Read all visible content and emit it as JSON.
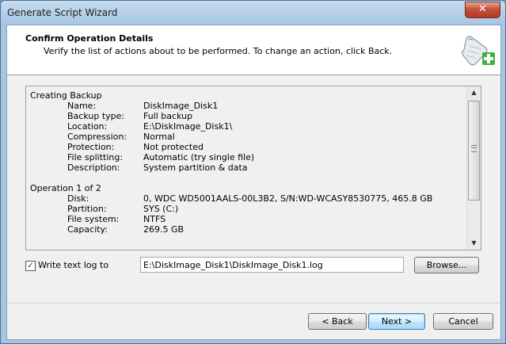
{
  "window": {
    "title": "Generate Script Wizard",
    "close_glyph": "✕"
  },
  "header": {
    "title": "Confirm Operation Details",
    "subtitle": "Verify the list of actions about to be performed. To change an action, click Back."
  },
  "operations": {
    "backup_heading": "Creating Backup",
    "backup_rows": [
      {
        "label": "Name:",
        "value": "DiskImage_Disk1"
      },
      {
        "label": "Backup type:",
        "value": "Full backup"
      },
      {
        "label": "Location:",
        "value": "E:\\DiskImage_Disk1\\"
      },
      {
        "label": "Compression:",
        "value": "Normal"
      },
      {
        "label": "Protection:",
        "value": "Not protected"
      },
      {
        "label": "File splitting:",
        "value": "Automatic (try single file)"
      },
      {
        "label": "Description:",
        "value": "System partition & data"
      }
    ],
    "operation_heading": "Operation 1 of 2",
    "operation_rows": [
      {
        "label": "Disk:",
        "value": "0, WDC WD5001AALS-00L3B2, S/N:WD-WCASY8530775, 465.8 GB"
      },
      {
        "label": "Partition:",
        "value": "SYS (C:)"
      },
      {
        "label": "File system:",
        "value": "NTFS"
      },
      {
        "label": "Capacity:",
        "value": "269.5 GB"
      }
    ]
  },
  "log": {
    "checkbox_label": "Write text log to",
    "checked": true,
    "check_glyph": "✓",
    "path": "E:\\DiskImage_Disk1\\DiskImage_Disk1.log",
    "browse_label": "Browse..."
  },
  "buttons": {
    "back": "< Back",
    "next": "Next >",
    "cancel": "Cancel"
  },
  "scrollbar": {
    "up_glyph": "▲",
    "down_glyph": "▼"
  },
  "colors": {
    "accent": "#3c7fb1",
    "close": "#c7503a",
    "icon_green": "#3cb043"
  }
}
